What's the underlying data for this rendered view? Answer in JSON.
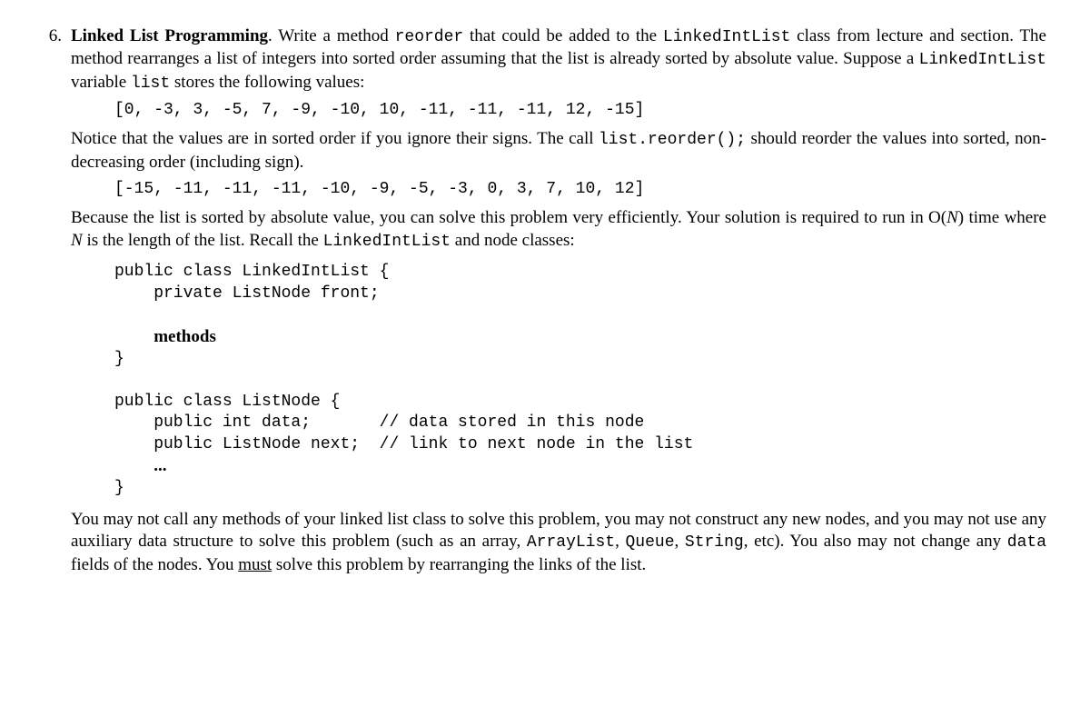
{
  "problem_number": "6.",
  "title_bold": "Linked List Programming",
  "period": ".",
  "intro_1a": "  Write a method ",
  "code_reorder": "reorder",
  "intro_1b": " that could be added to the ",
  "code_lil": "LinkedIntList",
  "intro_1c": " class from lecture and section.  The method rearranges a list of integers into sorted order assuming that the list is already sorted by absolute value.  Suppose a ",
  "code_lil2": "LinkedIntList",
  "intro_1d": " variable ",
  "code_list": "list",
  "intro_1e": " stores the following values:",
  "list_before": "[0, -3, 3, -5, 7, -9, -10, 10, -11, -11, -11, 12, -15]",
  "notice_a": "Notice that the values are in sorted order if you ignore their signs.  The call ",
  "code_call": "list.reorder();",
  "notice_b": " should reorder the values into sorted, non-decreasing order (including sign).",
  "list_after": "[-15, -11, -11, -11, -10, -9, -5, -3, 0, 3, 7, 10, 12]",
  "because_a": "Because the list is sorted by absolute value, you can solve this problem very efficiently.  Your solution is required to run in O(",
  "N1": "N",
  "because_b": ") time where ",
  "N2": "N",
  "because_c": " is the length of the list.  Recall the ",
  "code_lil3": "LinkedIntList",
  "because_d": " and node classes:",
  "code_lil_open": "public class LinkedIntList {",
  "code_lil_front": "    private ListNode front;",
  "methods_word": "methods",
  "code_lil_close": "}",
  "code_ln_open": "public class ListNode {",
  "code_ln_data": "    public int data;       // data stored in this node",
  "code_ln_next": "    public ListNode next;  // link to next node in the list",
  "code_ln_dots": "    ",
  "dots": "...",
  "code_ln_close": "}",
  "final_a": "You may not call any methods of your linked list class to solve this problem, you may not construct any new nodes, and you may not use any auxiliary data structure to solve this problem (such as an array, ",
  "code_arraylist": "ArrayList",
  "final_b": ", ",
  "code_queue": "Queue",
  "final_c": ", ",
  "code_string": "String",
  "final_d": ", etc).  You also may not change any ",
  "code_data": "data",
  "final_e": " fields of the nodes.  You ",
  "must": "must",
  "final_f": " solve this problem by rearranging the links of the list."
}
